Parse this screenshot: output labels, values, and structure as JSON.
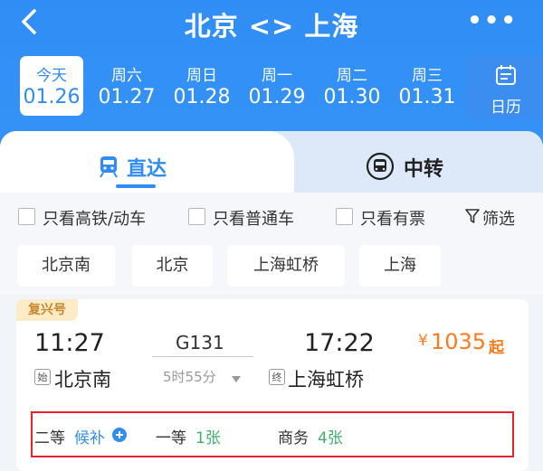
{
  "header": {
    "title": "北京 <> 上海",
    "more": "•••",
    "colors": {
      "primary": "#2f8df5",
      "accent": "#ff7a1a",
      "green": "#3fb06c",
      "red_outline": "#e8202a"
    }
  },
  "dates": [
    {
      "weekday": "今天",
      "date": "01.26",
      "selected": true
    },
    {
      "weekday": "周六",
      "date": "01.27"
    },
    {
      "weekday": "周日",
      "date": "01.28"
    },
    {
      "weekday": "周一",
      "date": "01.29"
    },
    {
      "weekday": "周二",
      "date": "01.30"
    },
    {
      "weekday": "周三",
      "date": "01.31"
    }
  ],
  "calendar": {
    "label": "日历",
    "icon": "calendar-icon"
  },
  "tabs": {
    "direct": "直达",
    "transfer": "中转"
  },
  "filters": {
    "high_speed": "只看高铁/动车",
    "normal": "只看普通车",
    "available": "只看有票",
    "filter": "筛选"
  },
  "stations": [
    "北京南",
    "北京",
    "上海虹桥",
    "上海"
  ],
  "train": {
    "badge": "复兴号",
    "depart_time": "11:27",
    "arrive_time": "17:22",
    "number": "G131",
    "duration": "5时55分",
    "depart_tag": "始",
    "depart_station": "北京南",
    "arrive_tag": "终",
    "arrive_station": "上海虹桥",
    "price_symbol": "¥",
    "price": "1035",
    "price_suffix": "起",
    "seats": [
      {
        "class": "二等",
        "status": "候补"
      },
      {
        "class": "一等",
        "status": "1张"
      },
      {
        "class": "商务",
        "status": "4张"
      }
    ]
  }
}
